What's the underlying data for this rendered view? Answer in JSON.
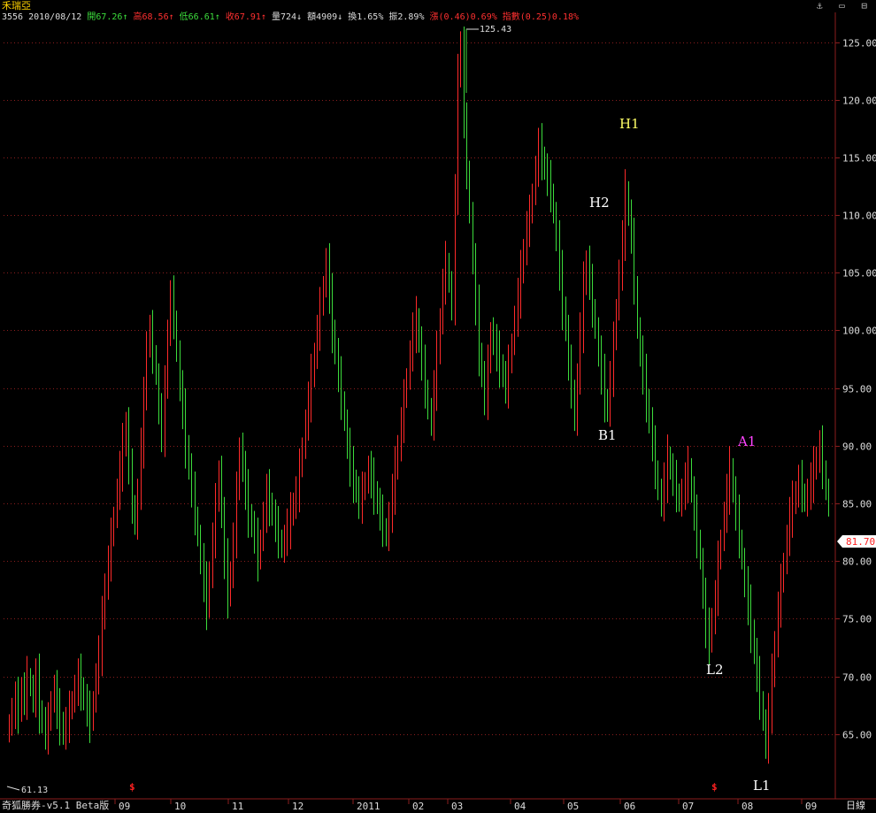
{
  "header": {
    "title": "禾瑞亞",
    "info": {
      "code_date": "3556 2010/08/12",
      "open": "開67.26↑",
      "high": "高68.56↑",
      "low": "低66.61↑",
      "close": "收67.91↑",
      "volume": "量724↓",
      "amount": "額4909↓",
      "turnover": "換1.65%",
      "amplitude": "振2.89%",
      "change": "漲(0.46)0.69%",
      "index": "指數(0.25)0.18%"
    },
    "window_icons": [
      "⚓",
      "▭",
      "⊟"
    ]
  },
  "colors": {
    "up": "#ff2a2a",
    "down": "#3cdc3c",
    "grid": "#8b1e1e",
    "axis_text": "#dddddd",
    "info_open": "#3cdc3c",
    "info_high": "#ff3030",
    "info_low": "#3cdc3c",
    "info_close": "#ff3030",
    "info_neutral": "#dddddd",
    "price_tag_bg": "#ffffff",
    "price_tag_fg": "#ff2020"
  },
  "chart_data": {
    "type": "ohlc",
    "y_ticks": [
      125.0,
      120.0,
      115.0,
      110.0,
      105.0,
      100.0,
      95.0,
      90.0,
      85.0,
      80.0,
      75.0,
      70.0,
      65.0
    ],
    "ylim": [
      60.0,
      126.5
    ],
    "x_labels": [
      "09",
      "10",
      "11",
      "12",
      "2011",
      "02",
      "03",
      "04",
      "05",
      "06",
      "07",
      "08",
      "09"
    ],
    "max_label": "125.43",
    "min_label": "61.13",
    "current_price": "81.70",
    "annotations": [
      {
        "text": "H1",
        "color": "#ffff66"
      },
      {
        "text": "H2",
        "color": "#ffffff"
      },
      {
        "text": "B1",
        "color": "#ffffff"
      },
      {
        "text": "A1",
        "color": "#ff44ff"
      },
      {
        "text": "L2",
        "color": "#ffffff"
      },
      {
        "text": "L1",
        "color": "#ffffff"
      }
    ],
    "marker_symbol": "$",
    "series_close": [
      66,
      67,
      68,
      67,
      69,
      68,
      70,
      69,
      68,
      70,
      67,
      66,
      65,
      66,
      68,
      69,
      67,
      66,
      65,
      66,
      67,
      68,
      69,
      70,
      69,
      68,
      67,
      66,
      68,
      70,
      72,
      75,
      78,
      80,
      82,
      84,
      86,
      88,
      90,
      92,
      88,
      85,
      83,
      86,
      90,
      94,
      99,
      100,
      98,
      96,
      93,
      91,
      95,
      100,
      103,
      101,
      98,
      95,
      93,
      90,
      88,
      86,
      84,
      82,
      80,
      78,
      76,
      79,
      82,
      85,
      88,
      84,
      80,
      77,
      79,
      82,
      86,
      90,
      88,
      86,
      84,
      83,
      82,
      80,
      82,
      84,
      86,
      85,
      84,
      83,
      82,
      81,
      82,
      83,
      84,
      85,
      86,
      88,
      90,
      92,
      94,
      96,
      98,
      100,
      102,
      104,
      106,
      103,
      100,
      98,
      96,
      94,
      92,
      90,
      88,
      87,
      86,
      85,
      86,
      87,
      88,
      87,
      86,
      85,
      84,
      83,
      82,
      84,
      86,
      88,
      90,
      92,
      94,
      96,
      98,
      100,
      101,
      99,
      97,
      95,
      93,
      92,
      95,
      98,
      101,
      104,
      106,
      104,
      102,
      112,
      122,
      125,
      118,
      114,
      110,
      106,
      102,
      98,
      96,
      94,
      97,
      100,
      99,
      98,
      97,
      96,
      95,
      97,
      99,
      101,
      103,
      105,
      107,
      109,
      110,
      112,
      114,
      116,
      115,
      114,
      113,
      112,
      110,
      108,
      105,
      102,
      100,
      97,
      95,
      92,
      96,
      100,
      104,
      106,
      104,
      102,
      100,
      98,
      96,
      94,
      93,
      96,
      99,
      102,
      105,
      108,
      112,
      110,
      108,
      104,
      100,
      98,
      96,
      94,
      92,
      90,
      88,
      86,
      85,
      87,
      89,
      88,
      87,
      86,
      85,
      86,
      87,
      88,
      86,
      84,
      82,
      80,
      77,
      74,
      73,
      75,
      77,
      80,
      82,
      84,
      86,
      88,
      86,
      84,
      82,
      80,
      78,
      76,
      74,
      72,
      70,
      68,
      66,
      64,
      67,
      70,
      73,
      76,
      78,
      80,
      82,
      84,
      85,
      86,
      87,
      86,
      85,
      86,
      87,
      88,
      89,
      90,
      88,
      86,
      85
    ]
  },
  "footer": {
    "app_label": "奇狐勝券-v5.1 Beta版",
    "period_button": "日線"
  }
}
